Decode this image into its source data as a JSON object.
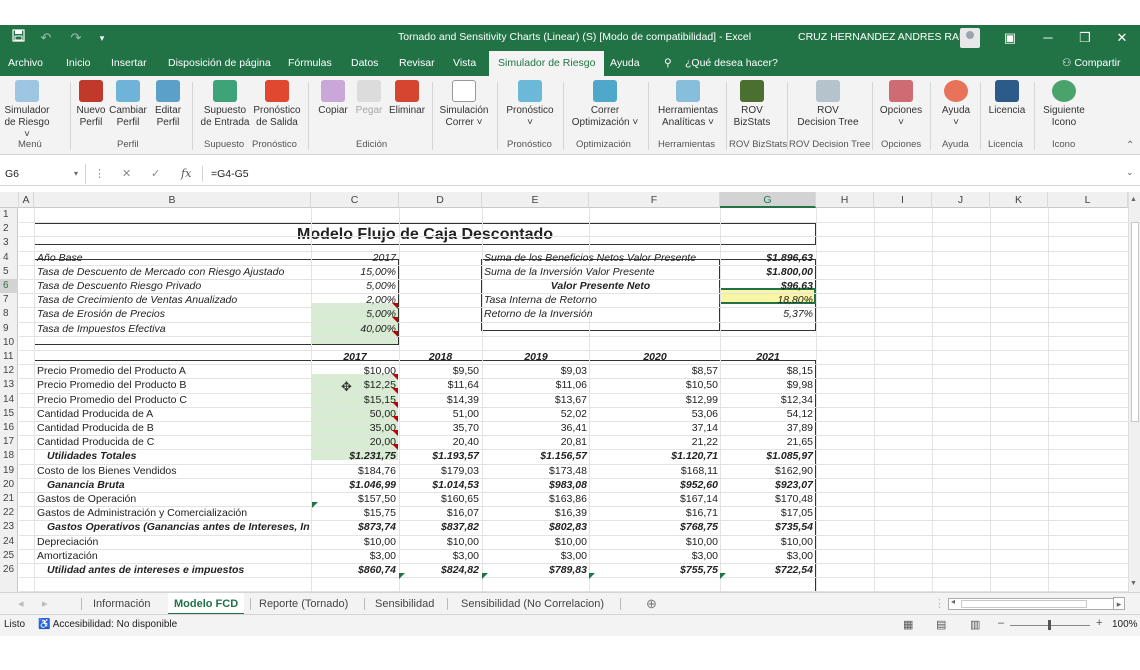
{
  "titlebar": {
    "title": "Tornado and Sensitivity Charts (Linear) (S)  [Modo de compatibilidad]  -  Excel",
    "user": "CRUZ HERNANDEZ ANDRES RAUL",
    "icons": [
      "save-icon",
      "undo-icon",
      "redo-icon",
      "customize-icon"
    ]
  },
  "menu": {
    "tabs": [
      "Archivo",
      "Inicio",
      "Insertar",
      "Disposición de página",
      "Fórmulas",
      "Datos",
      "Revisar",
      "Vista",
      "Simulador de Riesgo",
      "Ayuda"
    ],
    "active": "Simulador de Riesgo",
    "tellme": "¿Qué desea hacer?",
    "share": "Compartir"
  },
  "ribbon": {
    "buttons": [
      {
        "l1": "Simulador",
        "l2": "de Riesgo ˅"
      },
      {
        "l1": "Nuevo",
        "l2": "Perfil"
      },
      {
        "l1": "Cambiar",
        "l2": "Perfil"
      },
      {
        "l1": "Editar",
        "l2": "Perfil"
      },
      {
        "l1": "Supuesto",
        "l2": "de Entrada"
      },
      {
        "l1": "Pronóstico",
        "l2": "de Salida"
      },
      {
        "l1": "Copiar",
        "l2": ""
      },
      {
        "l1": "Pegar",
        "l2": ""
      },
      {
        "l1": "Eliminar",
        "l2": ""
      },
      {
        "l1": "Simulación",
        "l2": "Correr ˅"
      },
      {
        "l1": "Pronóstico",
        "l2": "˅"
      },
      {
        "l1": "Correr",
        "l2": "Optimización ˅"
      },
      {
        "l1": "Herramientas",
        "l2": "Analíticas ˅"
      },
      {
        "l1": "ROV",
        "l2": "BizStats"
      },
      {
        "l1": "ROV",
        "l2": "Decision Tree"
      },
      {
        "l1": "Opciones",
        "l2": "˅"
      },
      {
        "l1": "Ayuda",
        "l2": "˅"
      },
      {
        "l1": "Licencia",
        "l2": ""
      },
      {
        "l1": "Siguiente",
        "l2": "Icono"
      }
    ],
    "groups": [
      "Menú",
      "Perfil",
      "Supuesto",
      "Pronóstico",
      "Edición",
      "Pronóstico",
      "Optimización",
      "Herramientas",
      "ROV BizStats",
      "ROV Decision Tree",
      "Opciones",
      "Ayuda",
      "Licencia",
      "Icono"
    ]
  },
  "formula": {
    "cell": "G6",
    "fx": "fx",
    "value": "=G4-G5"
  },
  "columns": [
    "A",
    "B",
    "C",
    "D",
    "E",
    "F",
    "G",
    "H",
    "I",
    "J",
    "K",
    "L"
  ],
  "rows": [
    "1",
    "2",
    "3",
    "4",
    "5",
    "6",
    "7",
    "8",
    "9",
    "10",
    "11",
    "12",
    "13",
    "14",
    "15",
    "16",
    "17",
    "18",
    "19",
    "20",
    "21",
    "22",
    "23",
    "24",
    "25",
    "26"
  ],
  "sheet": {
    "title": "Modelo Flujo de Caja Descontado",
    "params": [
      {
        "label": "Año Base",
        "value": "2017"
      },
      {
        "label": "Tasa de Descuento de Mercado con Riesgo Ajustado",
        "value": "15,00%"
      },
      {
        "label": "Tasa de Descuento Riesgo Privado",
        "value": "5,00%"
      },
      {
        "label": "Tasa de Crecimiento de Ventas Anualizado",
        "value": "2,00%"
      },
      {
        "label": "Tasa de Erosión de Precios",
        "value": "5,00%"
      },
      {
        "label": "Tasa de Impuestos Efectiva",
        "value": "40,00%"
      }
    ],
    "summary": [
      {
        "label": "Suma de los Beneficios Netos Valor Presente",
        "value": "$1.896,63"
      },
      {
        "label": "Suma de la Inversión Valor Presente",
        "value": "$1.800,00"
      },
      {
        "label": "Valor Presente Neto",
        "value": "$96,63"
      },
      {
        "label": "Tasa Interna de Retorno",
        "value": "18,80%"
      },
      {
        "label": "Retorno de la Inversión",
        "value": "5,37%"
      }
    ],
    "years": [
      "2017",
      "2018",
      "2019",
      "2020",
      "2021"
    ],
    "table": [
      {
        "label": "Precio Promedio del Producto A",
        "v": [
          "$10,00",
          "$9,50",
          "$9,03",
          "$8,57",
          "$8,15"
        ]
      },
      {
        "label": "Precio Promedio del Producto B",
        "v": [
          "$12,25",
          "$11,64",
          "$11,06",
          "$10,50",
          "$9,98"
        ]
      },
      {
        "label": "Precio Promedio del Producto C",
        "v": [
          "$15,15",
          "$14,39",
          "$13,67",
          "$12,99",
          "$12,34"
        ]
      },
      {
        "label": "Cantidad Producida de A",
        "v": [
          "50,00",
          "51,00",
          "52,02",
          "53,06",
          "54,12"
        ]
      },
      {
        "label": "Cantidad Producida de B",
        "v": [
          "35,00",
          "35,70",
          "36,41",
          "37,14",
          "37,89"
        ]
      },
      {
        "label": "Cantidad Producida de C",
        "v": [
          "20,00",
          "20,40",
          "20,81",
          "21,22",
          "21,65"
        ]
      },
      {
        "label": "Utilidades Totales",
        "v": [
          "$1.231,75",
          "$1.193,57",
          "$1.156,57",
          "$1.120,71",
          "$1.085,97"
        ],
        "bold": true
      },
      {
        "label": "Costo de los Bienes Vendidos",
        "v": [
          "$184,76",
          "$179,03",
          "$173,48",
          "$168,11",
          "$162,90"
        ]
      },
      {
        "label": "Ganancia Bruta",
        "v": [
          "$1.046,99",
          "$1.014,53",
          "$983,08",
          "$952,60",
          "$923,07"
        ],
        "bold": true
      },
      {
        "label": "Gastos de Operación",
        "v": [
          "$157,50",
          "$160,65",
          "$163,86",
          "$167,14",
          "$170,48"
        ]
      },
      {
        "label": "Gastos de Administración y Comercialización",
        "v": [
          "$15,75",
          "$16,07",
          "$16,39",
          "$16,71",
          "$17,05"
        ]
      },
      {
        "label": "Gastos Operativos (Ganancias antes de Intereses, In",
        "v": [
          "$873,74",
          "$837,82",
          "$802,83",
          "$768,75",
          "$735,54"
        ],
        "bold": true
      },
      {
        "label": "Depreciación",
        "v": [
          "$10,00",
          "$10,00",
          "$10,00",
          "$10,00",
          "$10,00"
        ]
      },
      {
        "label": "Amortización",
        "v": [
          "$3,00",
          "$3,00",
          "$3,00",
          "$3,00",
          "$3,00"
        ]
      },
      {
        "label": "Utilidad antes de intereses e impuestos",
        "v": [
          "$860,74",
          "$824,82",
          "$789,83",
          "$755,75",
          "$722,54"
        ],
        "bold": true
      }
    ]
  },
  "sheettabs": [
    "Información",
    "Modelo FCD",
    "Reporte (Tornado)",
    "Sensibilidad",
    "Sensibilidad (No Correlacion)"
  ],
  "active_sheet": "Modelo FCD",
  "status": {
    "ready": "Listo",
    "accessibility": "Accesibilidad: No disponible",
    "zoom": "100%"
  }
}
